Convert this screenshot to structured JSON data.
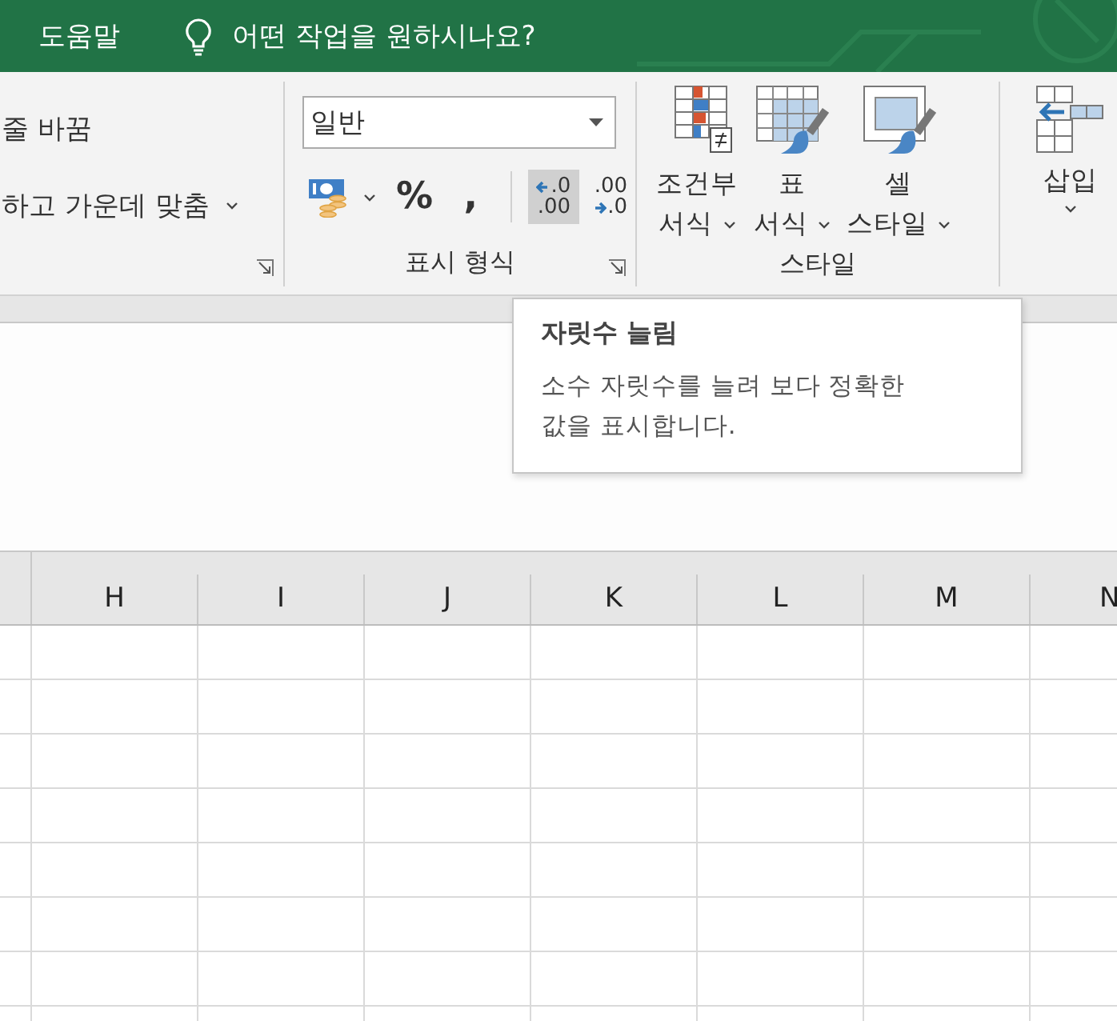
{
  "tab_bar": {
    "tab": "도움말",
    "search": {
      "placeholder": "어떤 작업을 원하시나요?"
    }
  },
  "ribbon": {
    "alignment_group": {
      "buttons": [
        {
          "label": "줄 바꿈",
          "dropdown": false
        },
        {
          "label": "하고 가운데 맞춤",
          "dropdown": true
        }
      ]
    },
    "number_group": {
      "format": "일반",
      "label": "표시 형식",
      "buttons": [
        {
          "kind": "currency",
          "highlighted": false
        },
        {
          "kind": "symbol",
          "text": "%",
          "highlighted": false
        },
        {
          "kind": "symbol",
          "text": ",",
          "highlighted": false
        },
        {
          "kind": "increase-decimal",
          "top": ".0",
          "bottom": ".00",
          "highlighted": true
        },
        {
          "kind": "decrease-decimal",
          "top": ".00",
          "bottom": ".0",
          "highlighted": false
        }
      ]
    },
    "styles_group": {
      "label": "스타일",
      "buttons": [
        {
          "kind": "conditional",
          "label": "조건부\n서식"
        },
        {
          "kind": "table",
          "label": "표\n서식"
        },
        {
          "kind": "cell",
          "label": "셀\n스타일"
        }
      ]
    },
    "cells_group": {
      "buttons": [
        {
          "kind": "insert",
          "label": "삽입"
        }
      ]
    }
  },
  "tooltip": {
    "title": "자릿수 늘림",
    "body": "소수 자릿수를 늘려 보다 정확한 값을 표시합니다."
  },
  "sheet": {
    "columns": [
      "H",
      "I",
      "J",
      "K",
      "L",
      "M",
      "N"
    ]
  }
}
